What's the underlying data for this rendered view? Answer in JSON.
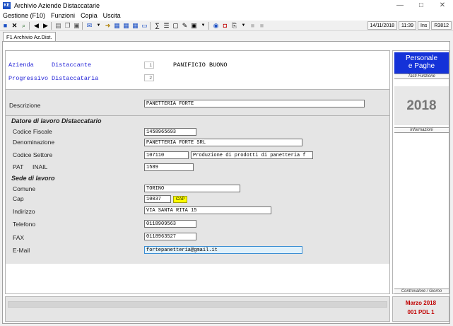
{
  "window": {
    "title": "Archivio Aziende Distaccatarie",
    "icon": "KE",
    "minimize": "—",
    "maximize": "□",
    "close": "✕"
  },
  "menu": [
    "Gestione (F10)",
    "Funzioni",
    "Copia",
    "Uscita"
  ],
  "toolbar": {
    "date": "14/11/2018",
    "time": "11:39",
    "ins": "Ins",
    "release": "R3812"
  },
  "tab": {
    "label": "F1 Archivio Az.Dist."
  },
  "header": {
    "azienda_label": "Azienda",
    "distaccante_label": "Distaccante",
    "azienda_num": "1",
    "azienda_name": "PANIFICIO BUONO",
    "progressivo_label": "Progressivo",
    "distaccataria_label": "Distaccataria",
    "progressivo_num": "2"
  },
  "descrizione": {
    "label": "Descrizione",
    "value": "PANETTERIA FORTE"
  },
  "datore": {
    "section_title": "Datore di lavoro Distaccatario",
    "codice_fiscale_label": "Codice Fiscale",
    "codice_fiscale": "1458965693",
    "denominazione_label": "Denominazione",
    "denominazione": "PANETTERIA FORTE SRL",
    "codice_settore_label": "Codice Settore",
    "codice_settore": "107110",
    "settore_desc": "Produzione di prodotti di panetteria f",
    "pat_label": "PAT",
    "inail_label": "INAIL",
    "pat": "1589"
  },
  "sede": {
    "section_title": "Sede di lavoro",
    "comune_label": "Comune",
    "comune": "TORINO",
    "cap_label": "Cap",
    "cap": "10037",
    "cap_button": "CAP",
    "indirizzo_label": "Indirizzo",
    "indirizzo": "VIA SANTA RITA 15",
    "telefono_label": "Telefono",
    "telefono": "0118909563",
    "fax_label": "FAX",
    "fax": "0118963527",
    "email_label": "E-Mail",
    "email": "fortepanetteria@gmail.it"
  },
  "right_panel": {
    "logo_line1": "Personale",
    "logo_line2": "e Paghe",
    "tasti_funzione": "Tasti Funzione",
    "year": "2018",
    "informazioni": "Informazioni",
    "controvalore": "Controvalore / Giorno",
    "month_year": "Marzo    2018",
    "code": "001 PDL 1"
  },
  "colors": {
    "accent_blue": "#1432d8",
    "label_blue": "#1f1fd6",
    "date_red": "#c00000",
    "cap_yellow": "#ffff00"
  }
}
